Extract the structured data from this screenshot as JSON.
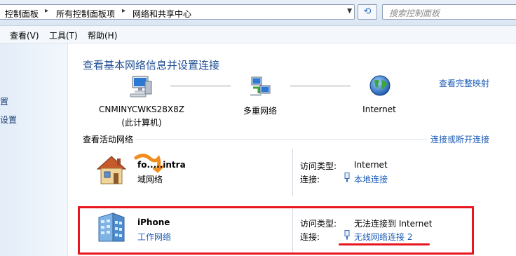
{
  "address_bar": {
    "crumbs": [
      "控制面板",
      "所有控制面板项",
      "网络和共享中心"
    ]
  },
  "search": {
    "placeholder": "搜索控制面板"
  },
  "menu": {
    "items": [
      "查看(V)",
      "工具(T)",
      "帮助(H)"
    ]
  },
  "left_pane": {
    "fragments": [
      "置",
      "设置"
    ]
  },
  "main": {
    "title": "查看基本网络信息并设置连接",
    "full_map_link": "查看完整映射",
    "map_nodes": [
      {
        "label": "CNMINYCWKS28X8Z",
        "sublabel": "(此计算机)",
        "icon": "computer-icon"
      },
      {
        "label": "多重网络",
        "icon": "multi-network-icon"
      },
      {
        "label": "Internet",
        "icon": "globe-icon"
      }
    ],
    "active_networks_label": "查看活动网络",
    "connect_disconnect_link": "连接或断开连接",
    "networks": [
      {
        "name": "fo.....intra",
        "type": "域网络",
        "type_is_link": false,
        "icon": "domain-house-icon",
        "access_label": "访问类型:",
        "access_value": "Internet",
        "connection_label": "连接:",
        "connection_value": "本地连接",
        "connection_icon": "ethernet-icon"
      },
      {
        "name": "iPhone",
        "type": "工作网络",
        "type_is_link": true,
        "icon": "work-network-building-icon",
        "access_label": "访问类型:",
        "access_value": "无法连接到 Internet",
        "connection_label": "连接:",
        "connection_value": "无线网络连接 2",
        "connection_icon": "wireless-icon"
      }
    ]
  },
  "colors": {
    "link": "#1d5db7",
    "title": "#1f4e96",
    "annotation_red": "#e8161e"
  }
}
